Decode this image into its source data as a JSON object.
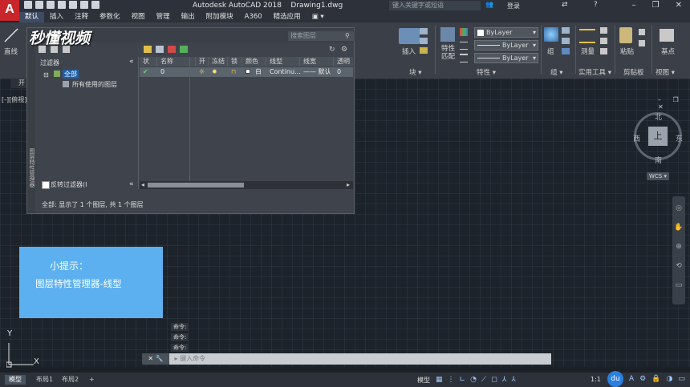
{
  "app": {
    "logo_letter": "A",
    "title": "Autodesk AutoCAD 2018",
    "document": "Drawing1.dwg",
    "search_placeholder": "键入关键字或短语",
    "login": "登录",
    "window_controls": [
      "–",
      "❐",
      "✕"
    ]
  },
  "menu": {
    "tabs": [
      "默认",
      "插入",
      "注释",
      "参数化",
      "视图",
      "管理",
      "输出",
      "附加模块",
      "A360",
      "精选应用",
      "▣ ▾"
    ],
    "active": 0
  },
  "ribbon": {
    "draw_label": "直线",
    "insert_label": "插入",
    "block_panel": "块 ▾",
    "match_props_label": "特性\n匹配",
    "bylayer_color": "ByLayer",
    "bylayer_linetype": "ByLayer",
    "bylayer_lineweight": "ByLayer",
    "properties_panel": "特性 ▾",
    "group_label": "组",
    "group_panel": "组 ▾",
    "measure_label": "测量",
    "utilities_panel": "实用工具 ▾",
    "paste_label": "粘贴",
    "clipboard_panel": "剪贴板",
    "base_label": "基点",
    "view_panel": "视图 ▾"
  },
  "file_tab": "开",
  "viewport_label": "[-][俯视]",
  "watermark": "秒懂视频",
  "layer_manager": {
    "search_placeholder": "搜索图层",
    "filters_title": "过滤器",
    "tree_all": "全部",
    "tree_used": "所有使用的图层",
    "invert_filter": "反转过滤器(I",
    "collapse": "«",
    "side_title": "图层特性管理器",
    "columns": [
      "状",
      "名称",
      "开",
      "冻结",
      "锁",
      "颜色",
      "线型",
      "线宽",
      "透明度"
    ],
    "row": {
      "status": "✔",
      "name": "0",
      "color": "白",
      "linetype": "Continu...",
      "lineweight": "—— 默认",
      "transparency": "0"
    },
    "status_text": "全部: 显示了 1 个图层, 共 1 个图层"
  },
  "hint": {
    "title": "小提示：",
    "body": "图层特性管理器-线型"
  },
  "viewcube": {
    "north": "北",
    "south": "南",
    "east": "东",
    "west": "西",
    "top": "上",
    "wcs": "WCS ▾"
  },
  "command": {
    "history": [
      "命令:",
      "命令:",
      "命令:"
    ],
    "placeholder": "键入命令"
  },
  "ucs": {
    "y": "Y",
    "x": "X"
  },
  "layout_tabs": [
    "模型",
    "布局1",
    "布局2",
    "+"
  ],
  "status_bar": {
    "model": "模型",
    "scale": "1:1"
  },
  "colors": {
    "accent": "#5db0f0",
    "logo_red": "#c8262a",
    "canvas": "#1d232b"
  }
}
